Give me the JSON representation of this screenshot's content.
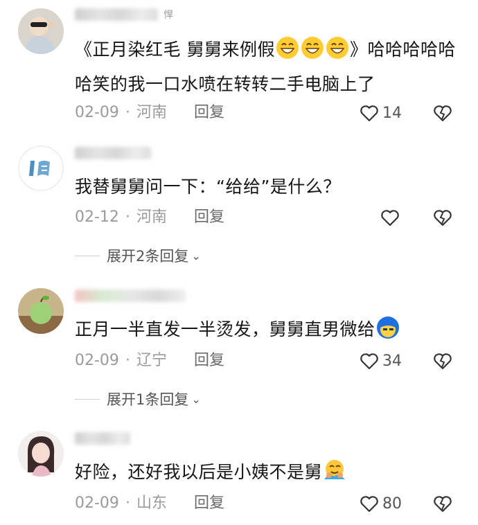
{
  "comments": [
    {
      "username_tail": "悍",
      "text_parts": [
        "《正月染红毛 舅舅来例假",
        "》哈哈哈哈哈哈笑的我一口水喷在转转二手电脑上了"
      ],
      "date": "02-09",
      "location": "河南",
      "reply_label": "回复",
      "like_count": "14"
    },
    {
      "text": "我替舅舅问一下：“给给”是什么？",
      "date": "02-12",
      "location": "河南",
      "reply_label": "回复",
      "expand_label": "展开2条回复"
    },
    {
      "text": "正月一半直发一半烫发，舅舅直男微给",
      "date": "02-09",
      "location": "辽宁",
      "reply_label": "回复",
      "like_count": "34",
      "expand_label": "展开1条回复"
    },
    {
      "text": "好险，还好我以后是小姨不是舅",
      "date": "02-09",
      "location": "山东",
      "reply_label": "回复",
      "like_count": "80"
    }
  ],
  "separator": "·",
  "icons": {
    "like": "heart-outline-icon",
    "dislike": "broken-heart-icon",
    "expand": "chevron-down-icon"
  },
  "colors": {
    "text": "#161616",
    "meta": "#9a9a9a",
    "icon": "#333333"
  }
}
